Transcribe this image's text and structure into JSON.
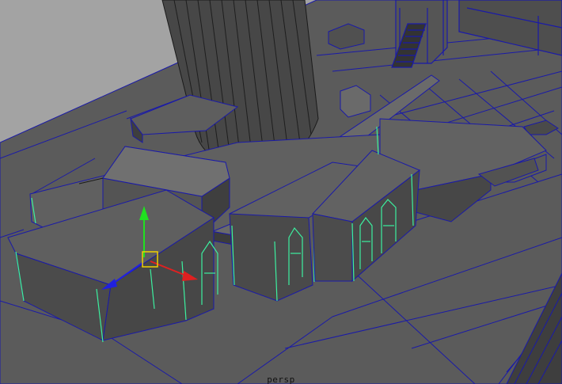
{
  "viewport": {
    "camera_label": "persp"
  },
  "colors": {
    "background": "#a3a3a3",
    "deck": "#5a5a5a",
    "wireframe": "#1a1aa8",
    "selected_wire": "#3cf0a0",
    "axis_x": "#e02020",
    "axis_y": "#20e020",
    "axis_z": "#2020e0",
    "pivot": "#f0d000"
  },
  "icons": {
    "manipulator": "move-manipulator-icon"
  }
}
